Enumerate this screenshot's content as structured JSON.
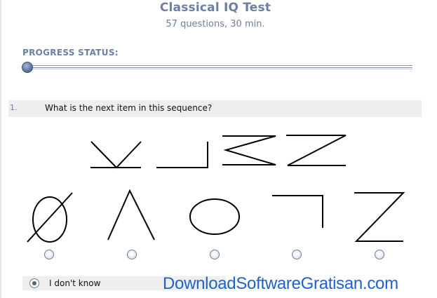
{
  "test": {
    "title": "Classical IQ Test",
    "subtitle": "57 questions, 30 min."
  },
  "progress": {
    "label": "PROGRESS STATUS:",
    "fraction": 0.015
  },
  "question": {
    "number": "1.",
    "text": "What is the next item in this sequence?",
    "sequence_items": [
      "k-shape",
      "l-shape",
      "m-shape",
      "n-shape"
    ],
    "answer_options": [
      "circle-slash-option",
      "inverted-v-option",
      "ellipse-option",
      "corner-option",
      "z-option"
    ]
  },
  "dont_know": {
    "label": "I don't know",
    "selected": true
  },
  "watermark": {
    "text": "DownloadSoftwareGratisan.com"
  },
  "colors": {
    "heading": "#6a7fa3",
    "watermark": "#1e63c9",
    "question_bar": "#eeeeee"
  }
}
